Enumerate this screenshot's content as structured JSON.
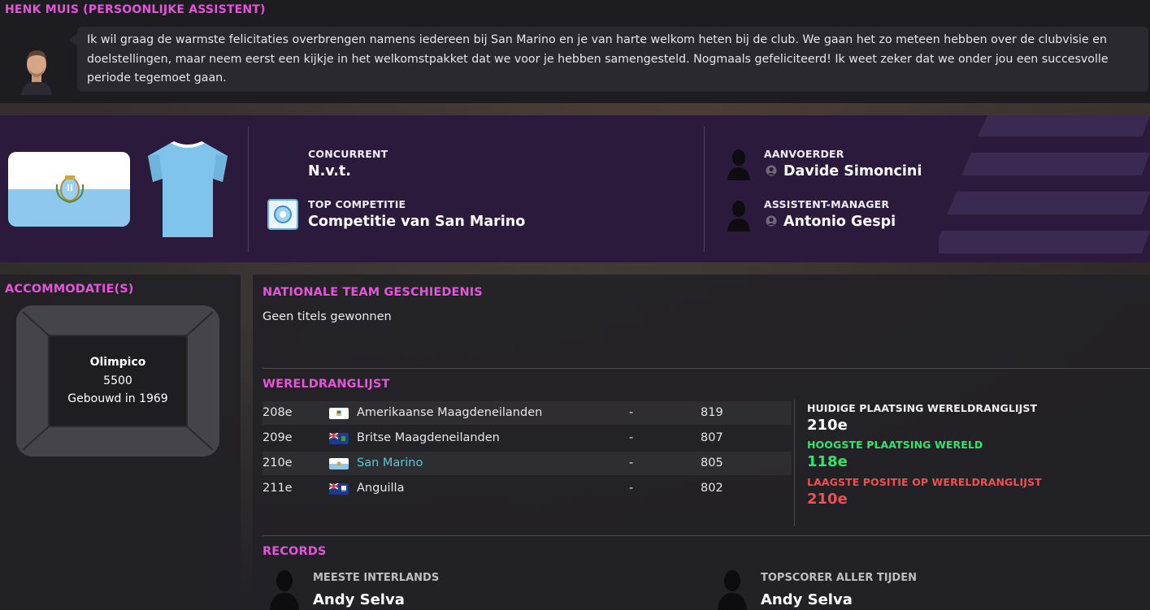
{
  "assistant": {
    "name": "HENK MUIS (PERSOONLIJKE ASSISTENT)",
    "message": "Ik wil graag de warmste felicitaties overbrengen namens iedereen bij San Marino en je van harte welkom heten bij de club. We gaan het zo meteen hebben over de clubvisie en doelstellingen, maar neem eerst een kijkje in het welkomstpakket dat we voor je hebben samengesteld. Nogmaals gefeliciteerd! Ik weet zeker dat we onder jou een succesvolle periode tegemoet gaan."
  },
  "club": {
    "rival_label": "CONCURRENT",
    "rival_value": "N.v.t.",
    "competition_label": "TOP COMPETITIE",
    "competition_value": "Competitie van San Marino",
    "captain_label": "AANVOERDER",
    "captain_value": "Davide Simoncini",
    "assistant_label": "ASSISTENT-MANAGER",
    "assistant_value": "Antonio Gespi",
    "colors": {
      "banner": "#2c1a3d",
      "shirt": "#7fc4ea",
      "flag_blue": "#8ec8ee"
    }
  },
  "facilities": {
    "title": "ACCOMMODATIE(S)",
    "stadium_name": "Olimpico",
    "capacity": "5500",
    "built": "Gebouwd in 1969"
  },
  "history": {
    "title": "NATIONALE TEAM GESCHIEDENIS",
    "text": "Geen titels gewonnen"
  },
  "ranking": {
    "title": "WERELDRANGLIJST",
    "rows": [
      {
        "rank": "208e",
        "country": "Amerikaanse Maagdeneilanden",
        "change": "-",
        "points": "819",
        "flag": "us-virgin-islands-flag",
        "highlight": false
      },
      {
        "rank": "209e",
        "country": "Britse Maagdeneilanden",
        "change": "-",
        "points": "807",
        "flag": "british-virgin-islands-flag",
        "highlight": false
      },
      {
        "rank": "210e",
        "country": "San Marino",
        "change": "-",
        "points": "805",
        "flag": "san-marino-flag",
        "highlight": true
      },
      {
        "rank": "211e",
        "country": "Anguilla",
        "change": "-",
        "points": "802",
        "flag": "anguilla-flag",
        "highlight": false
      }
    ],
    "current_label": "HUIDIGE PLAATSING WERELDRANGLIJST",
    "current_value": "210e",
    "highest_label": "HOOGSTE PLAATSING WERELD",
    "highest_value": "118e",
    "lowest_label": "LAAGSTE POSITIE OP WERELDRANGLIJST",
    "lowest_value": "210e",
    "colors": {
      "highlight": "#5bc8d8",
      "highest": "#2ee86a",
      "lowest": "#f05050"
    }
  },
  "records": {
    "title": "RECORDS",
    "most_caps_label": "MEESTE INTERLANDS",
    "most_caps_value": "Andy Selva",
    "top_scorer_label": "TOPSCORER ALLER TIJDEN",
    "top_scorer_value": "Andy Selva"
  }
}
